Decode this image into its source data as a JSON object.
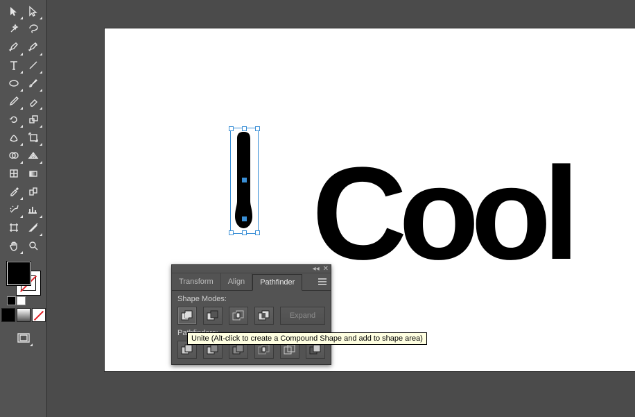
{
  "canvas": {
    "artwork_text": "Cool"
  },
  "panel": {
    "tabs": [
      "Transform",
      "Align",
      "Pathfinder"
    ],
    "active_tab": 2,
    "shape_modes_label": "Shape Modes:",
    "pathfinders_label": "Pathfinders:",
    "expand_label": "Expand",
    "tooltip": "Unite (Alt-click to create a Compound Shape and add to shape area)"
  },
  "swatches": {
    "fill": "#000000",
    "stroke": "none"
  },
  "tool_names": [
    "selection-tool",
    "direct-selection-tool",
    "magic-wand-tool",
    "lasso-tool",
    "pen-tool",
    "curvature-tool",
    "type-tool",
    "line-segment-tool",
    "ellipse-tool",
    "paintbrush-tool",
    "pencil-tool",
    "eraser-tool",
    "rotate-tool",
    "scale-tool",
    "width-tool",
    "free-transform-tool",
    "shape-builder-tool",
    "perspective-grid-tool",
    "mesh-tool",
    "gradient-tool",
    "eyedropper-tool",
    "blend-tool",
    "symbol-sprayer-tool",
    "column-graph-tool",
    "artboard-tool",
    "slice-tool",
    "hand-tool",
    "zoom-tool"
  ]
}
